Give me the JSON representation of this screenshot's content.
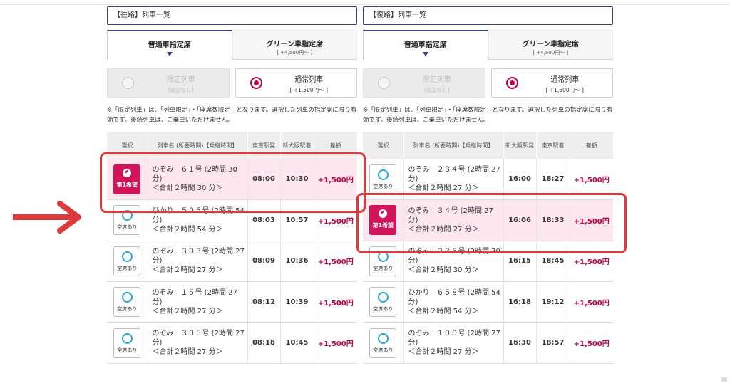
{
  "outbound": {
    "header": "【往路】列車一覧",
    "tabs": [
      {
        "label": "普通車指定席",
        "sub": ""
      },
      {
        "label": "グリーン車指定席",
        "sub": "[ +4,500円〜 ]"
      }
    ],
    "radios": [
      {
        "title": "限定列車",
        "sub": "[設定なし]"
      },
      {
        "title": "通常列車",
        "sub": "[ +1,500円〜 ]"
      }
    ],
    "note": "※「限定列車」は、「列車限定」・「座席数限定」となります。選択した列車の指定席に限り有効です。後続列車は、ご乗車いただけません。",
    "columns": [
      "選択",
      "列車名 (所要時間)【乗継時間】",
      "東京駅発",
      "新大阪駅着",
      "差額"
    ],
    "rows": [
      {
        "sel": "第1希望",
        "name1": "のぞみ　６１号 (2時間 30 分)",
        "name2": "＜合計２時間 30 分＞",
        "dep": "08:00",
        "arr": "10:30",
        "fare": "+1,500円"
      },
      {
        "sel": "空席あり",
        "name1": "ひかり　５０５号 (2時間 54 分)",
        "name2": "＜合計２時間 54 分＞",
        "dep": "08:03",
        "arr": "10:57",
        "fare": "+1,500円"
      },
      {
        "sel": "空席あり",
        "name1": "のぞみ　３０３号 (2時間 27 分)",
        "name2": "＜合計２時間 27 分＞",
        "dep": "08:09",
        "arr": "10:36",
        "fare": "+1,500円"
      },
      {
        "sel": "空席あり",
        "name1": "のぞみ　１５号 (2時間 27 分)",
        "name2": "＜合計２時間 27 分＞",
        "dep": "08:12",
        "arr": "10:39",
        "fare": "+1,500円"
      },
      {
        "sel": "空席あり",
        "name1": "のぞみ　３０５号 (2時間 27 分)",
        "name2": "＜合計２時間 27 分＞",
        "dep": "08:18",
        "arr": "10:45",
        "fare": "+1,500円"
      }
    ]
  },
  "return": {
    "header": "【復路】列車一覧",
    "tabs": [
      {
        "label": "普通車指定席",
        "sub": ""
      },
      {
        "label": "グリーン車指定席",
        "sub": "[ +4,500円〜 ]"
      }
    ],
    "radios": [
      {
        "title": "限定列車",
        "sub": "[設定なし]"
      },
      {
        "title": "通常列車",
        "sub": "[ +1,500円〜 ]"
      }
    ],
    "note": "※「限定列車」は、「列車限定」・「座席数限定」となります。選択した列車の指定席に限り有効です。後続列車は、ご乗車いただけません。",
    "columns": [
      "選択",
      "列車名 (所要時間)【乗継時間】",
      "新大阪駅発",
      "東京駅着",
      "差額"
    ],
    "rows": [
      {
        "sel": "空席あり",
        "name1": "のぞみ　２３４号 (2時間 27 分)",
        "name2": "＜合計２時間 27 分＞",
        "dep": "16:00",
        "arr": "18:27",
        "fare": "+1,500円"
      },
      {
        "sel": "第1希望",
        "name1": "のぞみ　３４号 (2時間 27 分)",
        "name2": "＜合計２時間 27 分＞",
        "dep": "16:06",
        "arr": "18:33",
        "fare": "+1,500円"
      },
      {
        "sel": "空席あり",
        "name1": "のぞみ　２３６号 (2時間 30 分)",
        "name2": "＜合計２時間 30 分＞",
        "dep": "16:15",
        "arr": "18:45",
        "fare": "+1,500円"
      },
      {
        "sel": "空席あり",
        "name1": "ひかり　６５８号 (2時間 54 分)",
        "name2": "＜合計２時間 54 分＞",
        "dep": "16:18",
        "arr": "19:12",
        "fare": "+1,500円"
      },
      {
        "sel": "空席あり",
        "name1": "のぞみ　１００号 (2時間 27 分)",
        "name2": "＜合計２時間 27 分＞",
        "dep": "16:30",
        "arr": "18:57",
        "fare": "+1,500円"
      }
    ]
  },
  "colors": {
    "accent": "#3b3e7e",
    "selected": "#d4145a",
    "fare": "#c5003e",
    "highlight_row": "#fde6ee",
    "seat_circle": "#2aa7d1",
    "annotation": "#dd3b3b"
  }
}
